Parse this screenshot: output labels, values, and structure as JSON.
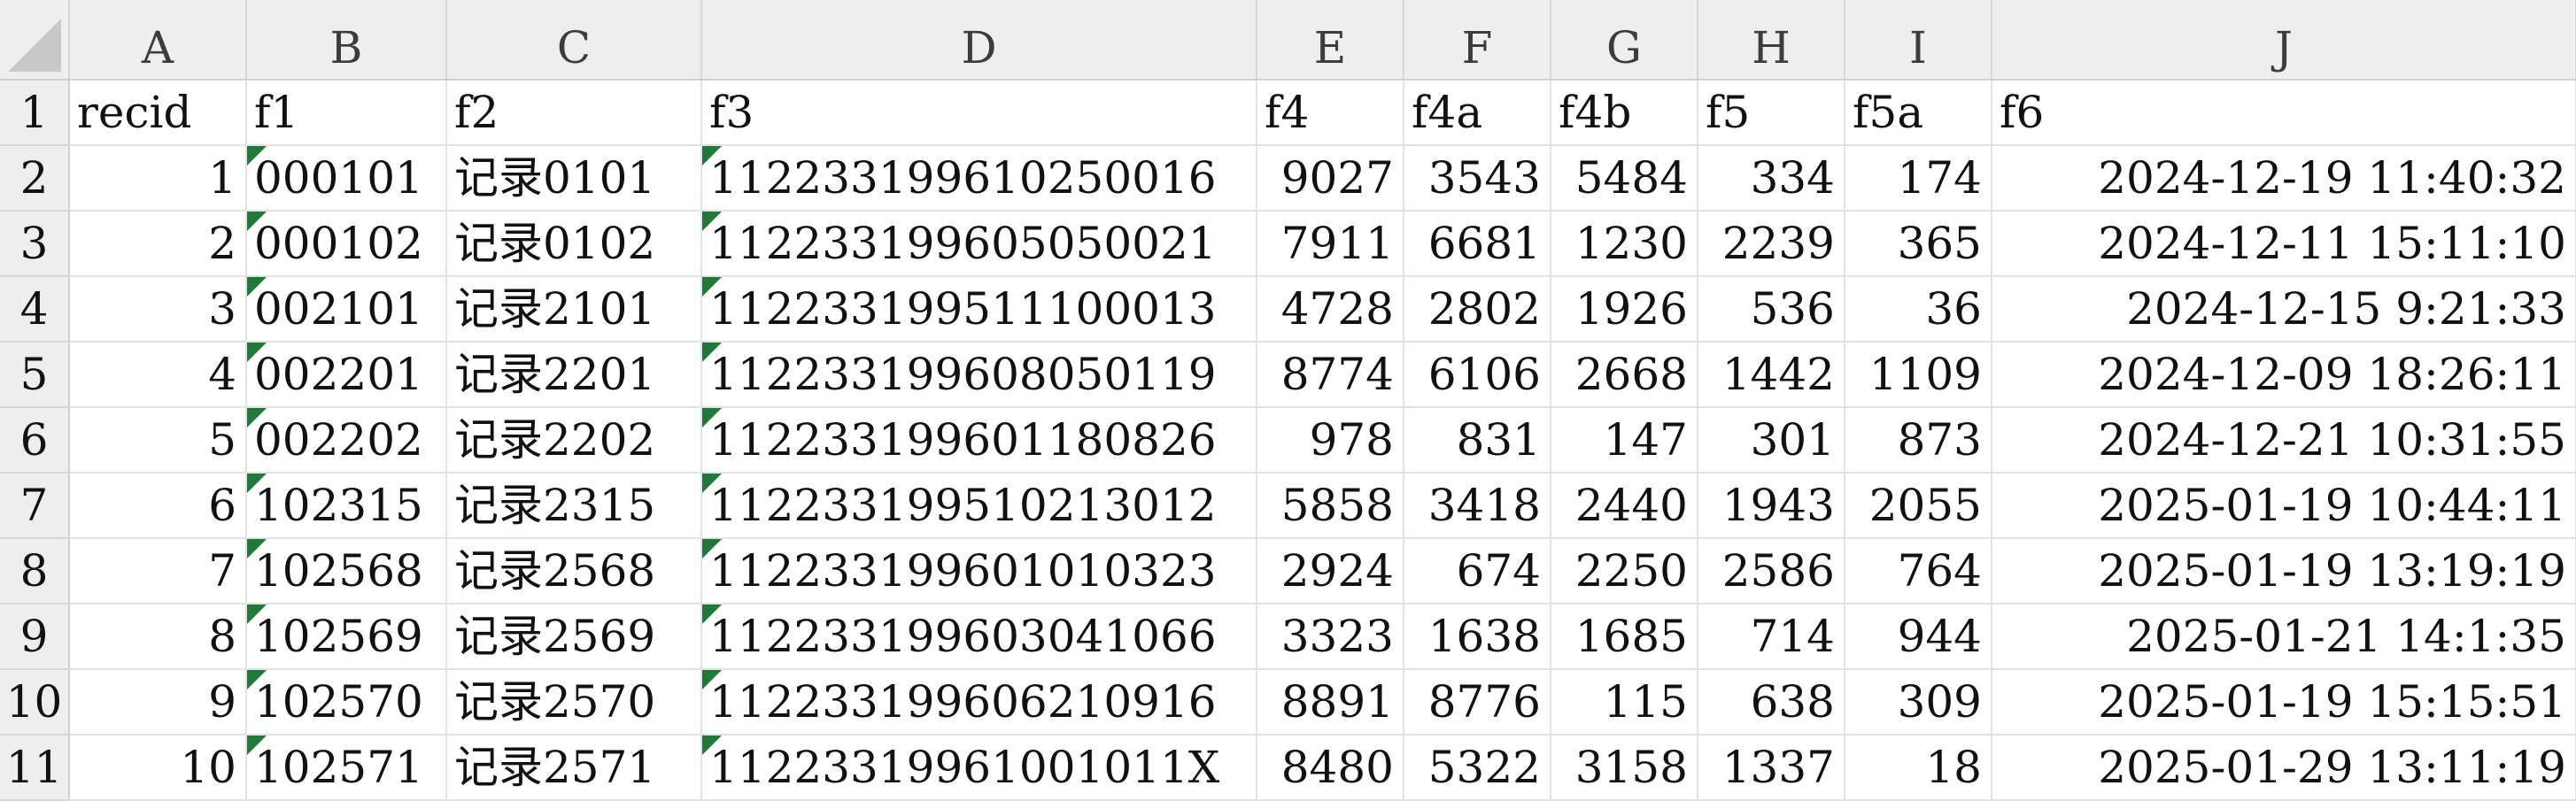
{
  "columns": [
    "A",
    "B",
    "C",
    "D",
    "E",
    "F",
    "G",
    "H",
    "I",
    "J"
  ],
  "rows": [
    {
      "num": "1",
      "cells": [
        "recid",
        "f1",
        "f2",
        "f3",
        "f4",
        "f4a",
        "f4b",
        "f5",
        "f5a",
        "f6"
      ]
    },
    {
      "num": "2",
      "cells": [
        "1",
        "000101",
        "记录0101",
        "112233199610250016",
        "9027",
        "3543",
        "5484",
        "334",
        "174",
        "2024-12-19  11:40:32"
      ]
    },
    {
      "num": "3",
      "cells": [
        "2",
        "000102",
        "记录0102",
        "112233199605050021",
        "7911",
        "6681",
        "1230",
        "2239",
        "365",
        "2024-12-11  15:11:10"
      ]
    },
    {
      "num": "4",
      "cells": [
        "3",
        "002101",
        "记录2101",
        "112233199511100013",
        "4728",
        "2802",
        "1926",
        "536",
        "36",
        "2024-12-15  9:21:33"
      ]
    },
    {
      "num": "5",
      "cells": [
        "4",
        "002201",
        "记录2201",
        "112233199608050119",
        "8774",
        "6106",
        "2668",
        "1442",
        "1109",
        "2024-12-09  18:26:11"
      ]
    },
    {
      "num": "6",
      "cells": [
        "5",
        "002202",
        "记录2202",
        "112233199601180826",
        "978",
        "831",
        "147",
        "301",
        "873",
        "2024-12-21  10:31:55"
      ]
    },
    {
      "num": "7",
      "cells": [
        "6",
        "102315",
        "记录2315",
        "112233199510213012",
        "5858",
        "3418",
        "2440",
        "1943",
        "2055",
        "2025-01-19  10:44:11"
      ]
    },
    {
      "num": "8",
      "cells": [
        "7",
        "102568",
        "记录2568",
        "112233199601010323",
        "2924",
        "674",
        "2250",
        "2586",
        "764",
        "2025-01-19  13:19:19"
      ]
    },
    {
      "num": "9",
      "cells": [
        "8",
        "102569",
        "记录2569",
        "112233199603041066",
        "3323",
        "1638",
        "1685",
        "714",
        "944",
        "2025-01-21  14:1:35"
      ]
    },
    {
      "num": "10",
      "cells": [
        "9",
        "102570",
        "记录2570",
        "112233199606210916",
        "8891",
        "8776",
        "115",
        "638",
        "309",
        "2025-01-19  15:15:51"
      ]
    },
    {
      "num": "11",
      "cells": [
        "10",
        "102571",
        "记录2571",
        "11223319961001011X",
        "8480",
        "5322",
        "3158",
        "1337",
        "18",
        "2025-01-29  13:11:19"
      ]
    }
  ],
  "colors": {
    "header_bg": "#eeeeee",
    "text_flag_green": "#1f7a3a",
    "gridline": "#e2e2e2"
  }
}
